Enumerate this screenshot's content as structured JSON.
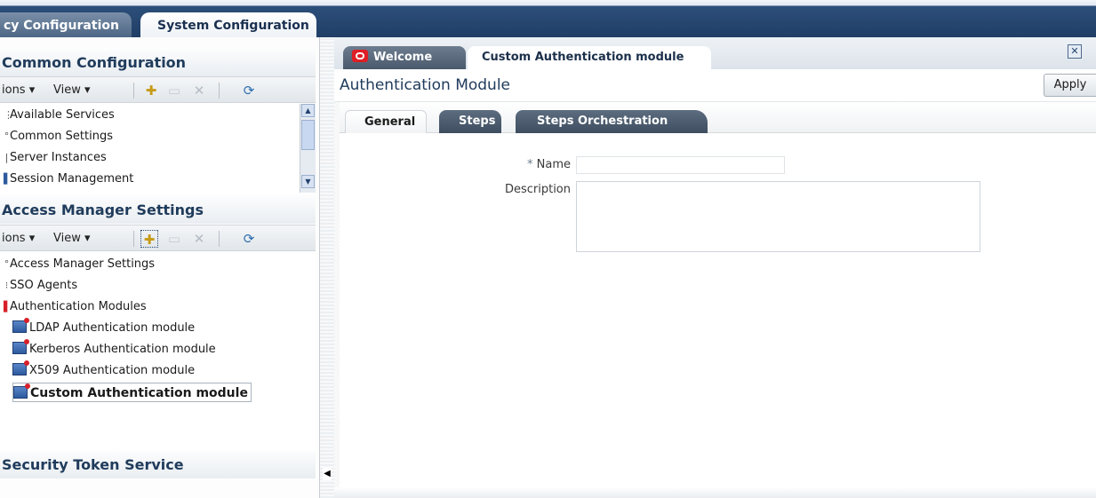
{
  "top_tabs": {
    "policy": "cy Configuration",
    "system": "System Configuration"
  },
  "common": {
    "header": "Common Configuration",
    "actions": "ions",
    "view": "View",
    "items": [
      "Available Services",
      "Common Settings",
      "Server Instances",
      "Session Management"
    ]
  },
  "access": {
    "header": "Access Manager Settings",
    "actions": "ions",
    "view": "View",
    "items": [
      "Access Manager Settings",
      "SSO Agents",
      "Authentication Modules",
      "LDAP Authentication module",
      "Kerberos Authentication module",
      "X509 Authentication module",
      "Custom Authentication module"
    ]
  },
  "sts": {
    "header": "Security Token Service"
  },
  "doc_tabs": {
    "welcome": "Welcome",
    "custom": "Custom Authentication module"
  },
  "page": {
    "title": "Authentication Module",
    "apply": "Apply"
  },
  "sub_tabs": {
    "general": "General",
    "steps": "Steps",
    "orchestration": "Steps Orchestration"
  },
  "form": {
    "required_mark": "*",
    "name_label": "Name",
    "name_value": "",
    "description_label": "Description",
    "description_value": ""
  },
  "icons": {
    "new": "new-icon",
    "open": "folder-icon",
    "delete": "delete-icon",
    "refresh": "refresh-icon",
    "module": "module-icon"
  },
  "colors": {
    "header_text": "#203c5c",
    "top_bar": "#203e66",
    "dark_tab": "#4a596b",
    "oracle_red": "#e01e25"
  }
}
